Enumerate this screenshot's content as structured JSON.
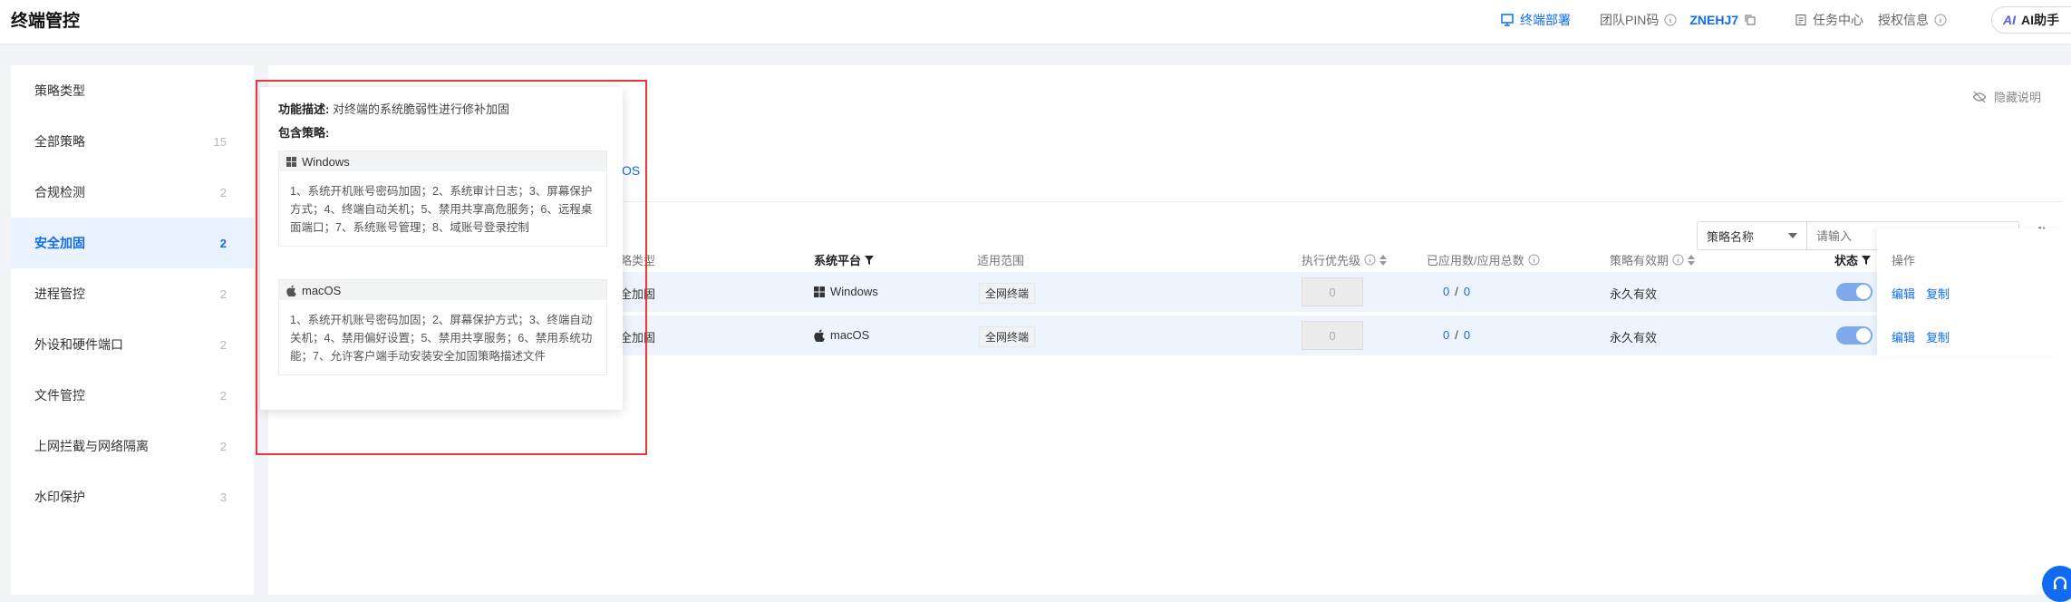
{
  "header": {
    "app_title": "终端管控",
    "deploy_label": "终端部署",
    "team_pin_label": "团队PIN码",
    "pin_code": "ZNEHJ7",
    "task_center_label": "任务中心",
    "license_label": "授权信息",
    "ai_label": "AI助手",
    "ai_logo": "AI"
  },
  "sidebar": {
    "items": [
      {
        "label": "策略类型",
        "count": ""
      },
      {
        "label": "全部策略",
        "count": "15"
      },
      {
        "label": "合规检测",
        "count": "2"
      },
      {
        "label": "安全加固",
        "count": "2"
      },
      {
        "label": "进程管控",
        "count": "2"
      },
      {
        "label": "外设和硬件端口",
        "count": "2"
      },
      {
        "label": "文件管控",
        "count": "2"
      },
      {
        "label": "上网拦截与网络隔离",
        "count": "2"
      },
      {
        "label": "水印保护",
        "count": "3"
      }
    ]
  },
  "main": {
    "hide_help_label": "隐藏说明",
    "os_tab_fragment": "OS",
    "filter": {
      "select_value": "策略名称",
      "search_placeholder": "请输入"
    },
    "columns": {
      "type": "略类型",
      "platform": "系统平台",
      "scope": "适用范围",
      "priority": "执行优先级",
      "applied": "已应用数/应用总数",
      "validity": "策略有效期",
      "status": "状态",
      "actions": "操作"
    },
    "rows": [
      {
        "type": "全加固",
        "platform": "Windows",
        "scope": "全网终端",
        "priority": "0",
        "applied": "0",
        "total": "0",
        "sep": "/",
        "validity": "永久有效",
        "edit": "编辑",
        "copy": "复制"
      },
      {
        "type": "全加固",
        "platform": "macOS",
        "scope": "全网终端",
        "priority": "0",
        "applied": "0",
        "total": "0",
        "sep": "/",
        "validity": "永久有效",
        "edit": "编辑",
        "copy": "复制"
      }
    ]
  },
  "popover": {
    "desc_label": "功能描述:",
    "desc_text": "对终端的系统脆弱性进行修补加固",
    "include_label": "包含策略:",
    "windows": {
      "title": "Windows",
      "body": "1、系统开机账号密码加固；2、系统审计日志；3、屏幕保护方式；4、终端自动关机；5、禁用共享高危服务；6、远程桌面端口；7、系统账号管理；8、域账号登录控制"
    },
    "macos": {
      "title": "macOS",
      "body": "1、系统开机账号密码加固；2、屏幕保护方式；3、终端自动关机；4、禁用偏好设置；5、禁用共享服务；6、禁用系统功能；7、允许客户端手动安装安全加固策略描述文件"
    }
  },
  "colors": {
    "accent": "#0f6cf2",
    "highlight_box": "#e8383d",
    "row_bg": "#eef4fd"
  }
}
